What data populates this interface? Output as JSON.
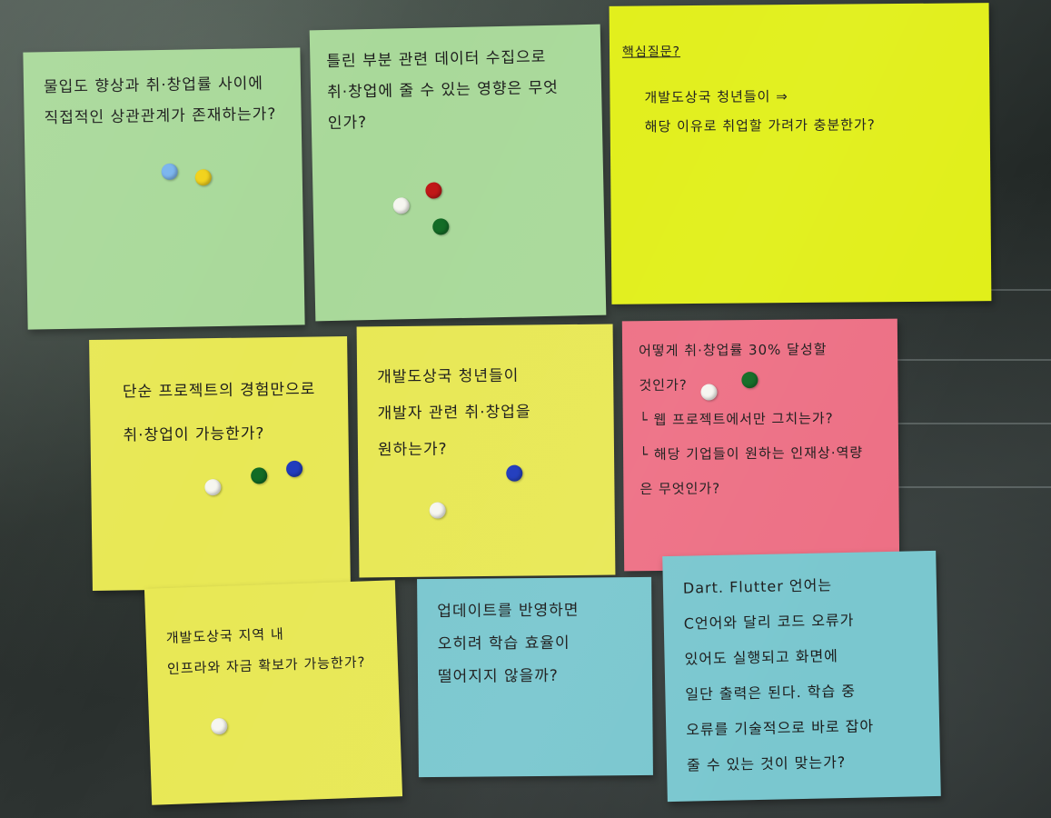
{
  "notes": [
    {
      "id": "note-1",
      "text": "물입도 향상과 취·창업률 사이에\n직접적인 상관관계가 존재하는가?",
      "dots": [
        "lightblue",
        "yellow"
      ]
    },
    {
      "id": "note-2",
      "text": "틀린 부분 관련 데이터 수집으로\n취·창업에 줄 수 있는 영향은 무엇\n인가?",
      "dots": [
        "white",
        "red",
        "green"
      ]
    },
    {
      "id": "note-3",
      "heading": "핵심질문?",
      "text": "개발도상국 청년들이 ⇒\n해당 이유로 취업할 가려가 충분한가?",
      "dots": []
    },
    {
      "id": "note-4",
      "text": "단순 프로젝트의 경험만으로\n취·창업이 가능한가?",
      "dots": [
        "white",
        "green",
        "blue"
      ]
    },
    {
      "id": "note-5",
      "text": "개발도상국 청년들이\n개발자 관련 취·창업을\n원하는가?",
      "dots": [
        "blue",
        "white"
      ]
    },
    {
      "id": "note-6",
      "text": "어떻게 취·창업률 30% 달성할\n것인가?\n└ 웹 프로젝트에서만 그치는가?\n└ 해당 기업들이 원하는 인재상·역량\n은 무엇인가?",
      "dots": [
        "white",
        "green"
      ]
    },
    {
      "id": "note-7",
      "text": "개발도상국 지역 내\n인프라와 자금 확보가 가능한가?",
      "dots": [
        "white"
      ]
    },
    {
      "id": "note-8",
      "text": "업데이트를 반영하면\n오히려 학습 효율이\n떨어지지 않을까?",
      "dots": []
    },
    {
      "id": "note-9",
      "text": "Dart. Flutter 언어는\nC언어와 달리 코드 오류가\n있어도 실행되고 화면에\n일단 출력은 된다. 학습 중\n오류를 기술적으로 바로 잡아\n줄 수 있는 것이 맞는가?",
      "dots": []
    }
  ]
}
